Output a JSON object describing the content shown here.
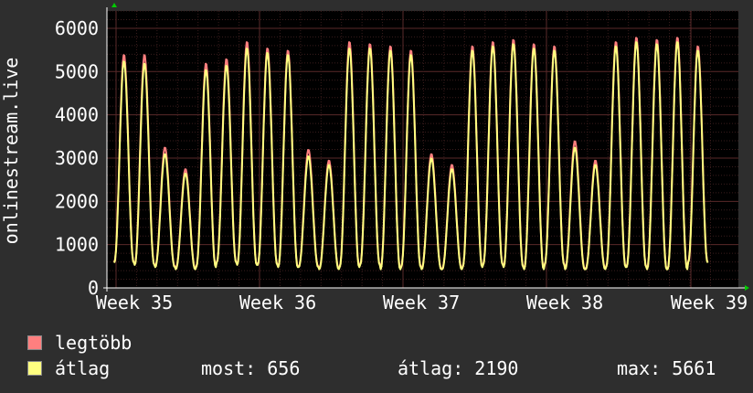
{
  "chart_data": {
    "type": "line",
    "ylabel": "onlinestream.live",
    "ylim": [
      0,
      6400
    ],
    "yticks": [
      0,
      1000,
      2000,
      3000,
      4000,
      5000,
      6000
    ],
    "xticks": [
      "Week 35",
      "Week 36",
      "Week 37",
      "Week 38",
      "Week 39"
    ],
    "grid": true,
    "days": 29,
    "series": [
      {
        "name": "legtöbb",
        "color": "#ff7f7f",
        "daily_peaks": [
          5400,
          5400,
          3250,
          2750,
          5200,
          5300,
          5700,
          5550,
          5500,
          3200,
          2950,
          5700,
          5650,
          5600,
          5500,
          3100,
          2850,
          5600,
          5700,
          5750,
          5650,
          5600,
          3400,
          2950,
          5700,
          5800,
          5750,
          5800,
          5600
        ],
        "daily_mins": [
          600,
          550,
          500,
          450,
          500,
          600,
          550,
          550,
          500,
          500,
          450,
          500,
          550,
          450,
          500,
          450,
          450,
          500,
          550,
          500,
          450,
          550,
          450,
          450,
          500,
          500,
          450,
          450,
          600
        ]
      },
      {
        "name": "átlag",
        "color": "#ffff80",
        "daily_peaks": [
          5250,
          5200,
          3100,
          2650,
          5050,
          5150,
          5550,
          5450,
          5400,
          3050,
          2850,
          5550,
          5550,
          5500,
          5400,
          3000,
          2750,
          5500,
          5600,
          5650,
          5550,
          5500,
          3250,
          2850,
          5600,
          5700,
          5650,
          5700,
          5500
        ],
        "daily_mins": [
          580,
          530,
          480,
          430,
          480,
          580,
          530,
          530,
          480,
          480,
          430,
          480,
          530,
          430,
          480,
          430,
          430,
          480,
          530,
          480,
          430,
          530,
          430,
          430,
          480,
          480,
          430,
          430,
          580
        ]
      }
    ]
  },
  "legend": {
    "max_label": "legtöbb",
    "avg_label": "átlag",
    "max_color": "#ff7f7f",
    "avg_color": "#ffff80",
    "most_text": "most: 656",
    "atlag_text": "átlag: 2190",
    "max_text": "max: 5661"
  }
}
